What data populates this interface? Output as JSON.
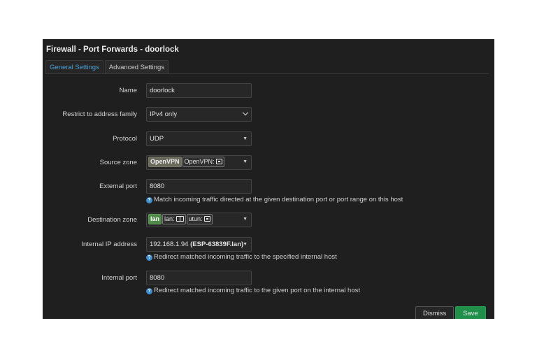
{
  "dialog": {
    "title": "Firewall - Port Forwards - doorlock",
    "tabs": [
      {
        "label": "General Settings"
      },
      {
        "label": "Advanced Settings"
      }
    ]
  },
  "form": {
    "name": {
      "label": "Name",
      "value": "doorlock"
    },
    "family": {
      "label": "Restrict to address family",
      "value": "IPv4 only"
    },
    "protocol": {
      "label": "Protocol",
      "value": "UDP"
    },
    "source_zone": {
      "label": "Source zone",
      "zone": "OpenVPN",
      "device": "OpenVPN:"
    },
    "external_port": {
      "label": "External port",
      "value": "8080",
      "help": "Match incoming traffic directed at the given destination port or port range on this host"
    },
    "dest_zone": {
      "label": "Destination zone",
      "zone": "lan",
      "device1": "lan:",
      "device2": "utun:"
    },
    "internal_ip": {
      "label": "Internal IP address",
      "value": "192.168.1.94",
      "host": "(ESP-63839F.lan)",
      "help": "Redirect matched incoming traffic to the specified internal host"
    },
    "internal_port": {
      "label": "Internal port",
      "value": "8080",
      "help": "Redirect matched incoming traffic to the given port on the internal host"
    }
  },
  "footer": {
    "dismiss": "Dismiss",
    "save": "Save"
  },
  "colors": {
    "accent": "#4aa3d8",
    "save": "#1f8f4a",
    "lan_zone": "#4f8a4a",
    "openvpn_zone": "#6b6b5d"
  }
}
